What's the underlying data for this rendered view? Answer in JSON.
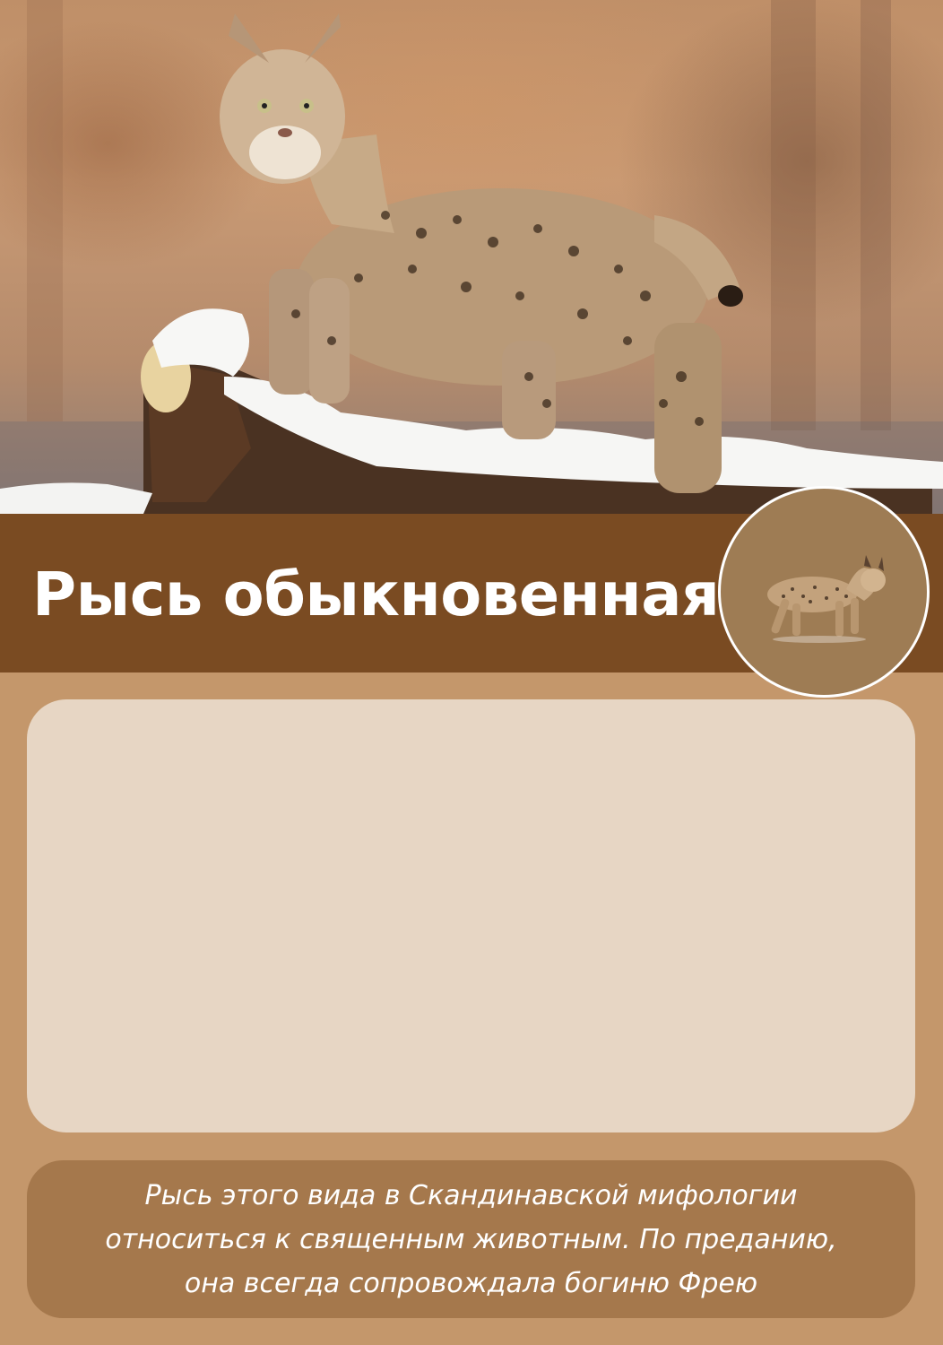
{
  "poster": {
    "photo": {
      "subject": "lynx standing on snowy log",
      "palette": [
        "#c99a74",
        "#7a4b22",
        "#ffffff"
      ]
    },
    "title": "Рысь обыкновенная",
    "badge": {
      "icon": "lynx-icon"
    },
    "info_panel": {
      "color": "#e7d6c4"
    },
    "fact": {
      "lines": [
        "Рысь этого вида в Скандинавской мифологии",
        "относиться к священным животным. По преданию,",
        "она всегда сопровождала богиню Фрею"
      ]
    }
  },
  "colors": {
    "background": "#c4976b",
    "title_band": "#7a4b22",
    "badge_fill": "#9e7c54",
    "fact_panel": "#a5784c"
  }
}
